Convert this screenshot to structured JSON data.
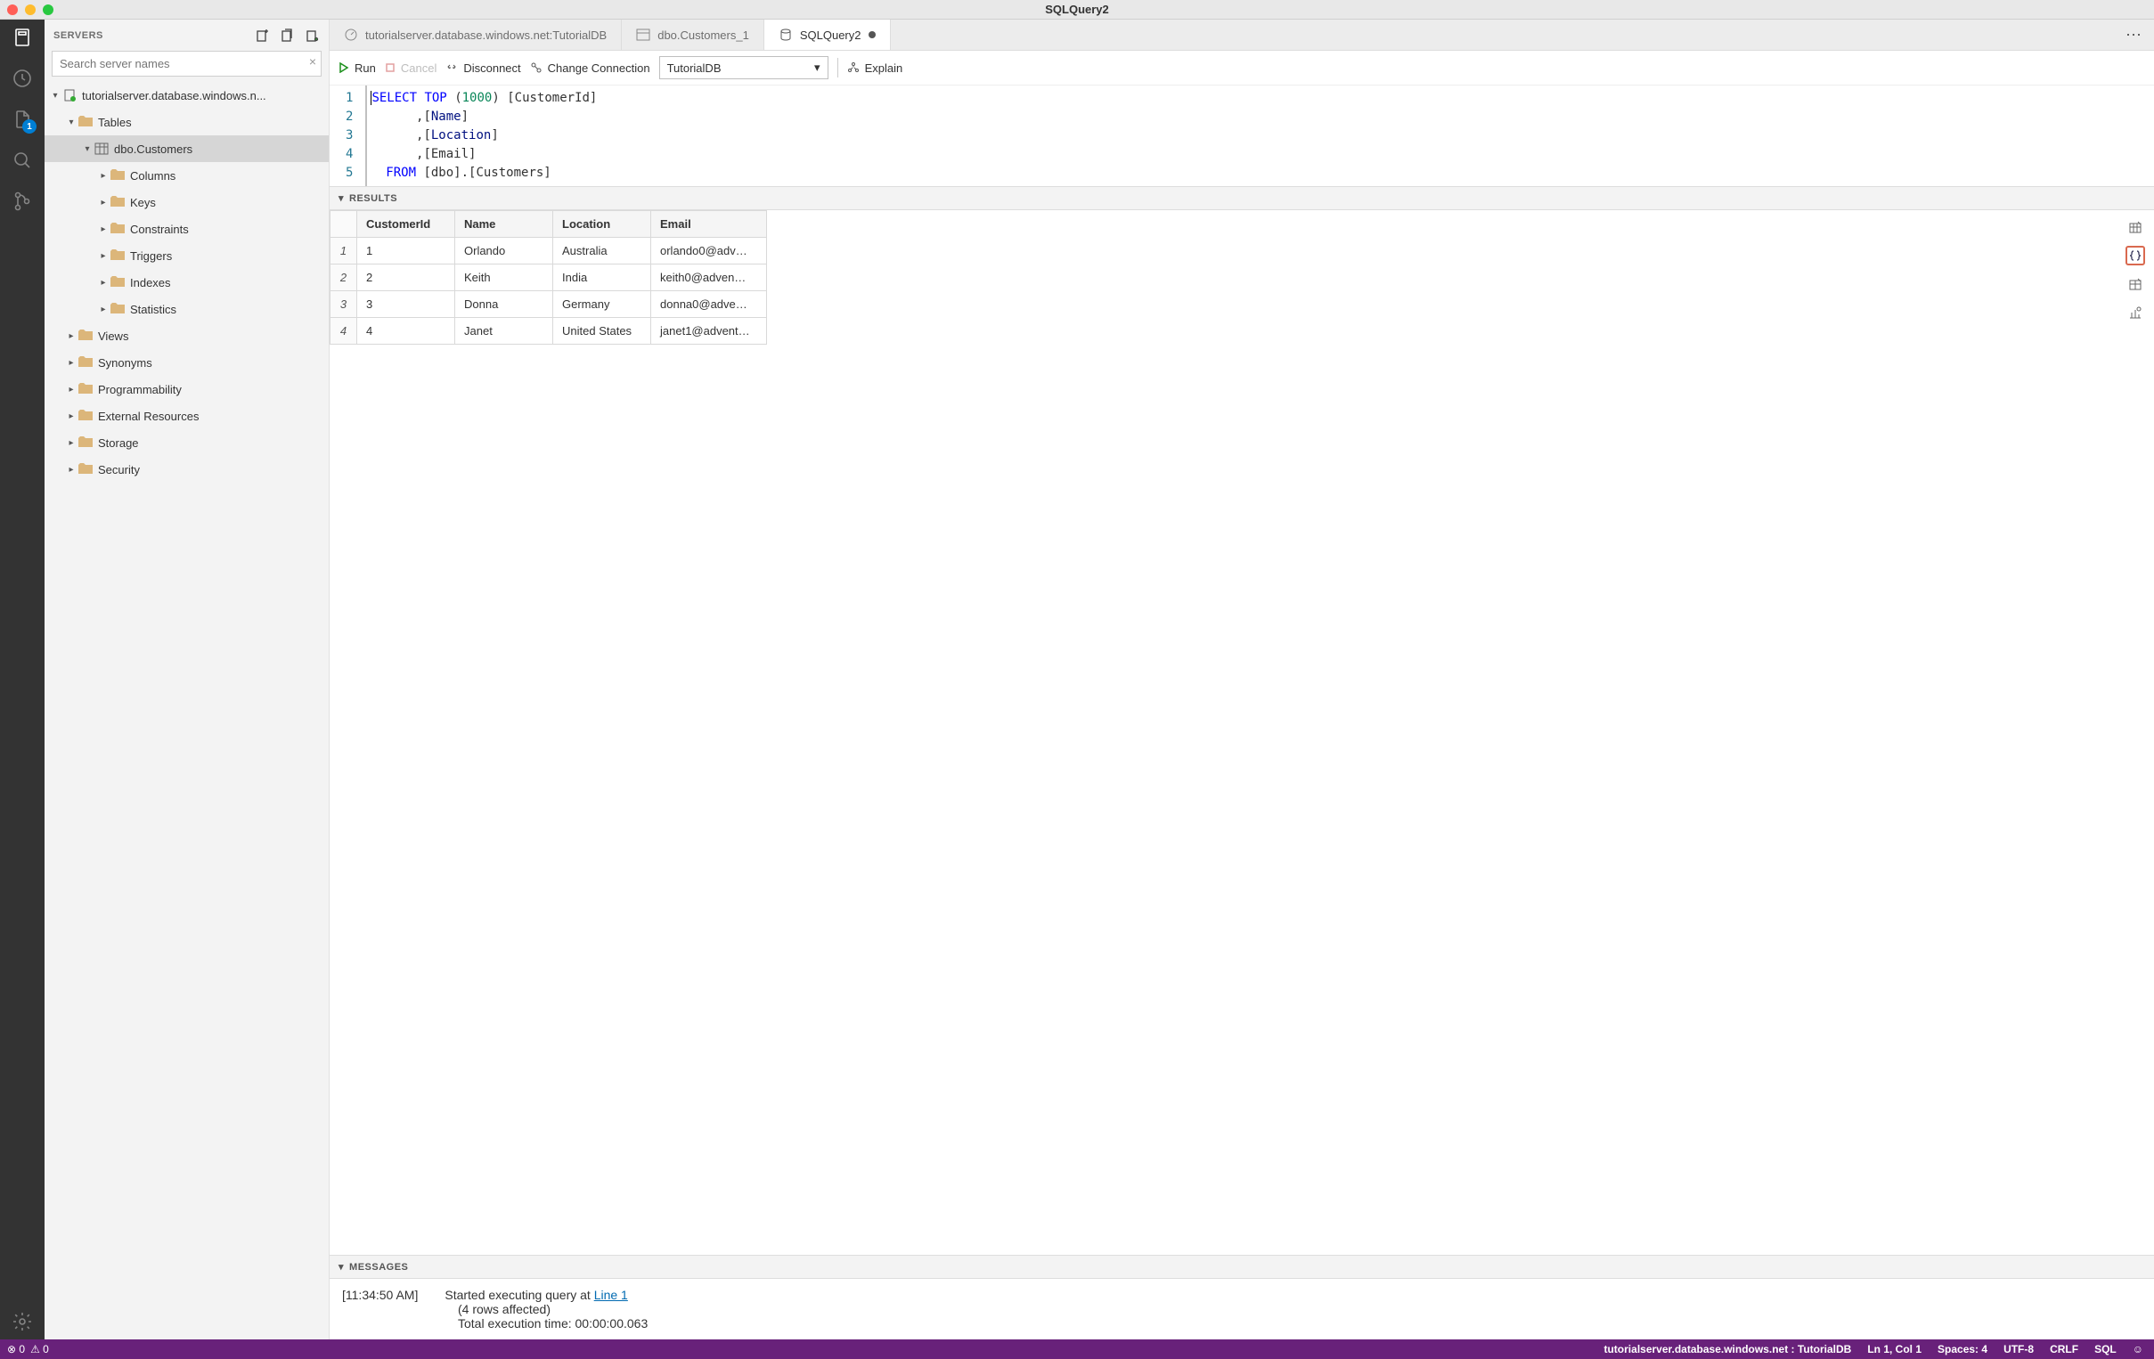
{
  "window": {
    "title": "SQLQuery2"
  },
  "sidebar": {
    "header": "SERVERS",
    "search_placeholder": "Search server names",
    "server_label": "tutorialserver.database.windows.n...",
    "nodes": {
      "tables": "Tables",
      "customers": "dbo.Customers",
      "columns": "Columns",
      "keys": "Keys",
      "constraints": "Constraints",
      "triggers": "Triggers",
      "indexes": "Indexes",
      "statistics": "Statistics",
      "views": "Views",
      "synonyms": "Synonyms",
      "programmability": "Programmability",
      "external": "External Resources",
      "storage": "Storage",
      "security": "Security"
    }
  },
  "tabs": {
    "t0": "tutorialserver.database.windows.net:TutorialDB",
    "t1": "dbo.Customers_1",
    "t2": "SQLQuery2"
  },
  "toolbar": {
    "run": "Run",
    "cancel": "Cancel",
    "disconnect": "Disconnect",
    "change": "Change Connection",
    "db": "TutorialDB",
    "explain": "Explain"
  },
  "editor": {
    "lines": [
      "1",
      "2",
      "3",
      "4",
      "5"
    ],
    "t_select": "SELECT",
    "t_top": "TOP",
    "t_open": "(",
    "t_1000": "1000",
    "t_close": ")",
    "t_cust": "[CustomerId]",
    "t_c2": ",[",
    "t_name": "Name",
    "t_brk": "]",
    "t_loc": "Location",
    "t_email": ",[Email]",
    "t_from": "FROM",
    "t_rest": " [dbo].[Customers]"
  },
  "results": {
    "title": "RESULTS",
    "headers": {
      "h1": "CustomerId",
      "h2": "Name",
      "h3": "Location",
      "h4": "Email"
    },
    "rows": [
      {
        "n": "1",
        "id": "1",
        "name": "Orlando",
        "loc": "Australia",
        "email": "orlando0@adv…"
      },
      {
        "n": "2",
        "id": "2",
        "name": "Keith",
        "loc": "India",
        "email": "keith0@adven…"
      },
      {
        "n": "3",
        "id": "3",
        "name": "Donna",
        "loc": "Germany",
        "email": "donna0@adve…"
      },
      {
        "n": "4",
        "id": "4",
        "name": "Janet",
        "loc": "United States",
        "email": "janet1@advent…"
      }
    ]
  },
  "messages": {
    "title": "MESSAGES",
    "time": "[11:34:50 AM]",
    "l1a": "Started executing query at ",
    "l1b": "Line 1",
    "l2": "(4 rows affected)",
    "l3": "Total execution time: 00:00:00.063"
  },
  "status": {
    "errors": "0",
    "warnings": "0",
    "conn": "tutorialserver.database.windows.net : TutorialDB",
    "pos": "Ln 1, Col 1",
    "spaces": "Spaces: 4",
    "enc": "UTF-8",
    "eol": "CRLF",
    "lang": "SQL"
  },
  "activity": {
    "badge": "1"
  }
}
